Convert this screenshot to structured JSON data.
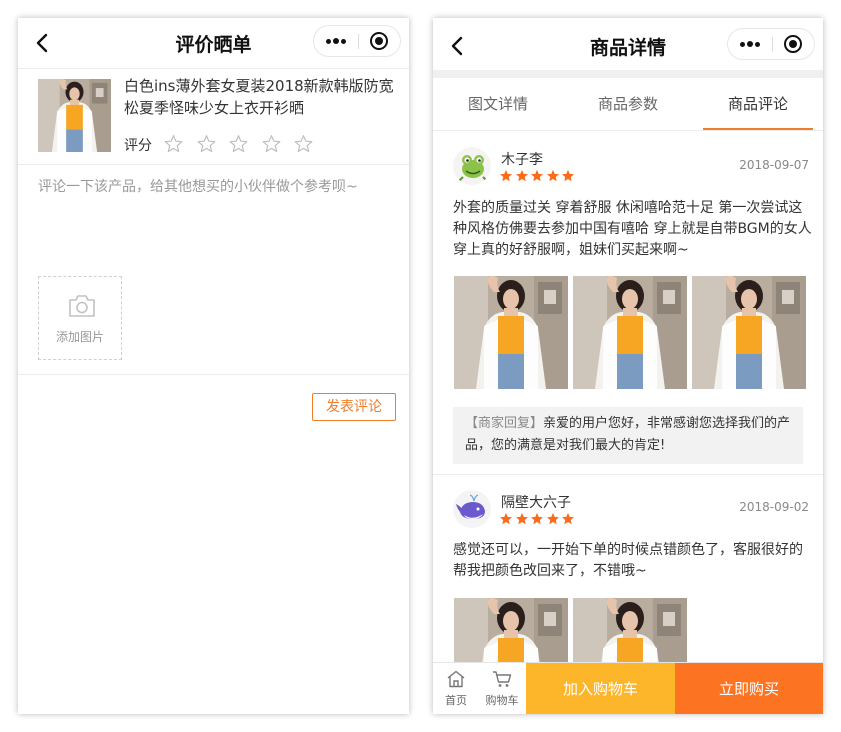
{
  "left": {
    "title": "评价晒单",
    "product_name": "白色ins薄外套女夏装2018新款韩版防宽松夏季怪味少女上衣开衫晒",
    "rate_label": "评分",
    "rating": 0,
    "rating_max": 5,
    "comment_placeholder": "评论一下该产品，给其他想买的小伙伴做个参考呗~",
    "add_photo_label": "添加图片",
    "submit_label": "发表评论"
  },
  "right": {
    "title": "商品详情",
    "tabs": [
      {
        "label": "图文详情",
        "active": false
      },
      {
        "label": "商品参数",
        "active": false
      },
      {
        "label": "商品评论",
        "active": true
      }
    ],
    "reviews": [
      {
        "user": "木子李",
        "avatar_icon": "frog-avatar-icon",
        "stars": 5,
        "date": "2018-09-07",
        "text": "外套的质量过关 穿着舒服 休闲嘻哈范十足 第一次尝试这种风格仿佛要去参加中国有嘻哈 穿上就是自带BGM的女人 穿上真的好舒服啊，姐妹们买起来啊~",
        "photo_count": 3,
        "reply_tag": "【商家回复】",
        "reply_text": "亲爱的用户您好，非常感谢您选择我们的产品，您的满意是对我们最大的肯定!"
      },
      {
        "user": "隔壁大六子",
        "avatar_icon": "whale-avatar-icon",
        "stars": 5,
        "date": "2018-09-02",
        "text": "感觉还可以，一开始下单的时候点错颜色了，客服很好的帮我把颜色改回来了，不错哦~",
        "photo_count": 2
      }
    ],
    "bottom_bar": {
      "home_label": "首页",
      "cart_label": "购物车",
      "add_cart_label": "加入购物车",
      "buy_now_label": "立即购买"
    }
  },
  "colors": {
    "accent_orange": "#f07d2a",
    "star_orange": "#fc6a1a",
    "add_cart_yellow": "#fdb52a",
    "buy_now_orange": "#fc7322"
  }
}
